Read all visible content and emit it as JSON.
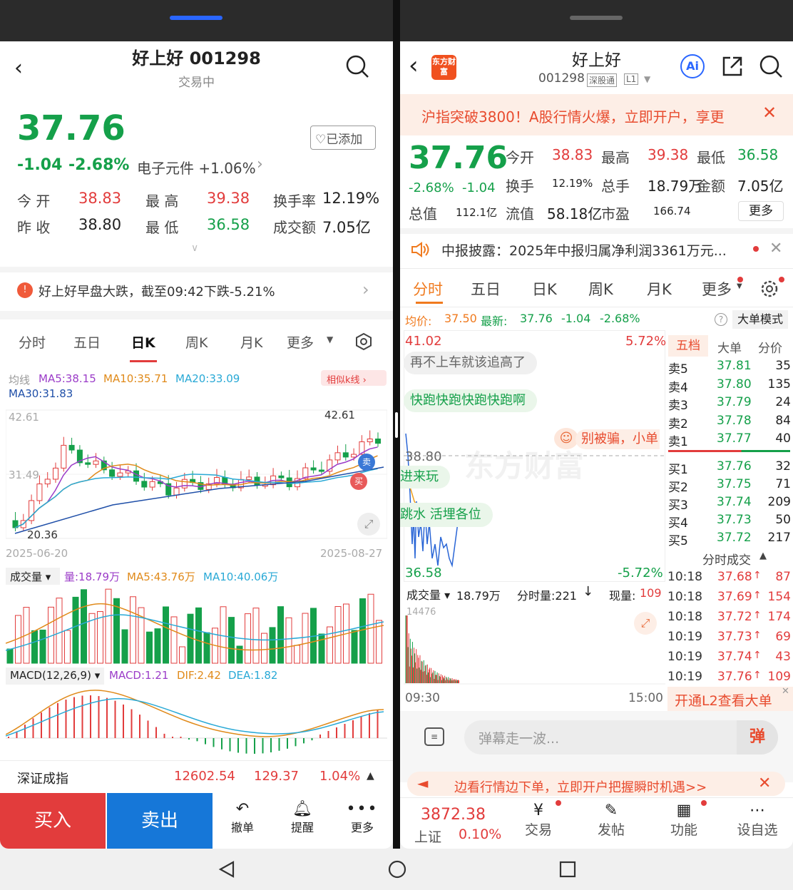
{
  "left": {
    "header": {
      "title": "好上好 001298",
      "status": "交易中"
    },
    "price": "37.76",
    "change": "-1.04",
    "change_pct": "-2.68%",
    "sector": "电子元件 +1.06%",
    "favorite_label": "已添加",
    "stats": [
      [
        "今 开",
        "38.83"
      ],
      [
        "最 高",
        "39.38"
      ],
      [
        "换手率",
        "12.19%"
      ],
      [
        "昨 收",
        "38.80"
      ],
      [
        "最 低",
        "36.58"
      ],
      [
        "成交额",
        "7.05亿"
      ]
    ],
    "news": "好上好早盘大跌，截至09:42下跌-5.21%",
    "tabs": [
      "分时",
      "五日",
      "日K",
      "周K",
      "月K",
      "更多"
    ],
    "ma_line1": [
      "均线",
      "MA5:38.15",
      "MA10:35.71",
      "MA20:33.09"
    ],
    "ma_line2": "MA30:31.83",
    "similar_k": "相似k线",
    "chart": {
      "y_top": "42.61",
      "y_mid": "31.49",
      "y_low": "20.36",
      "max_label": "42.61",
      "low_label": "20.36",
      "date_start": "2025-06-20",
      "date_end": "2025-08-27",
      "sell": "卖",
      "buy": "买"
    },
    "volume": [
      "成交量",
      "量:18.79万",
      "MA5:43.76万",
      "MA10:40.06万"
    ],
    "macd": [
      "MACD(12,26,9)",
      "MACD:1.21",
      "DIF:2.42",
      "DEA:1.82"
    ],
    "index": {
      "name": "深证成指",
      "value": "12602.54",
      "change": "129.37",
      "pct": "1.04%"
    },
    "bottom": {
      "buy": "买入",
      "sell": "卖出",
      "cancel": "撤单",
      "remind": "提醒",
      "more": "更多"
    }
  },
  "right": {
    "header": {
      "title": "好上好",
      "code": "001298",
      "badge1": "深股通",
      "badge2": "L1",
      "logo": "东方财富",
      "ai": "Ai"
    },
    "banner": "沪指突破3800！A股行情火爆，立即开户，享更",
    "price": "37.76",
    "change_pct": "-2.68%",
    "change": "-1.04",
    "stats": [
      [
        "今开",
        "38.83"
      ],
      [
        "最高",
        "39.38"
      ],
      [
        "最低",
        "36.58"
      ],
      [
        "换手",
        "12.19%"
      ],
      [
        "总手",
        "18.79万"
      ],
      [
        "金额",
        "7.05亿"
      ],
      [
        "总值",
        "112.1亿"
      ],
      [
        "流值",
        "58.18亿"
      ],
      [
        "市盈",
        "166.74"
      ]
    ],
    "more_btn": "更多",
    "notice": "中报披露：2025年中报归属净利润3361万元...",
    "tabs": [
      "分时",
      "五日",
      "日K",
      "周K",
      "月K",
      "更多"
    ],
    "avg_line": {
      "avg": "均价:",
      "avg_val": "37.50",
      "latest": "最新:",
      "latest_val": "37.76",
      "chg": "-1.04",
      "pct": "-2.68%",
      "mode": "大单模式"
    },
    "chart": {
      "top": "41.02",
      "top_pct": "5.72%",
      "mid": "38.80",
      "bottom": "36.58",
      "bottom_pct": "-5.72%",
      "time_start": "09:30",
      "time_end": "15:00",
      "vol_max": "14476",
      "watermark": "东方财富"
    },
    "danmaku": [
      "再不上车就该追高了",
      "快跑快跑快跑快跑啊",
      "别被骗，小单",
      "进来玩",
      "跳水  活埋各位"
    ],
    "vol_line": {
      "label": "成交量",
      "vol": "18.79万",
      "fs": "分时量:221",
      "now": "现量:",
      "now_val": "109"
    },
    "ob_tabs": [
      "五档",
      "大单",
      "分价"
    ],
    "sells": [
      [
        "卖5",
        "37.81",
        "35"
      ],
      [
        "卖4",
        "37.80",
        "135"
      ],
      [
        "卖3",
        "37.79",
        "24"
      ],
      [
        "卖2",
        "37.78",
        "84"
      ],
      [
        "卖1",
        "37.77",
        "40"
      ]
    ],
    "buys": [
      [
        "买1",
        "37.76",
        "32"
      ],
      [
        "买2",
        "37.75",
        "71"
      ],
      [
        "买3",
        "37.74",
        "209"
      ],
      [
        "买4",
        "37.73",
        "50"
      ],
      [
        "买5",
        "37.72",
        "217"
      ]
    ],
    "trades_title": "分时成交",
    "trades": [
      [
        "10:18",
        "37.68",
        "87"
      ],
      [
        "10:18",
        "37.69",
        "154"
      ],
      [
        "10:18",
        "37.72",
        "174"
      ],
      [
        "10:19",
        "37.73",
        "69"
      ],
      [
        "10:19",
        "37.74",
        "43"
      ],
      [
        "10:19",
        "37.76",
        "109"
      ]
    ],
    "l2": "开通L2查看大单",
    "comment_placeholder": "弹幕走一波...",
    "dan": "弹",
    "promo": "边看行情边下单，立即开户把握瞬时机遇>>",
    "bottom": {
      "index_val": "3872.38",
      "index_name": "上证",
      "index_pct": "0.10%",
      "trade": "交易",
      "post": "发帖",
      "func": "功能",
      "watch": "设自选"
    }
  },
  "colors": {
    "up": "#e23c3c",
    "down": "#15a04a",
    "accent_blue": "#1677ff",
    "orange": "#f07a1e"
  }
}
